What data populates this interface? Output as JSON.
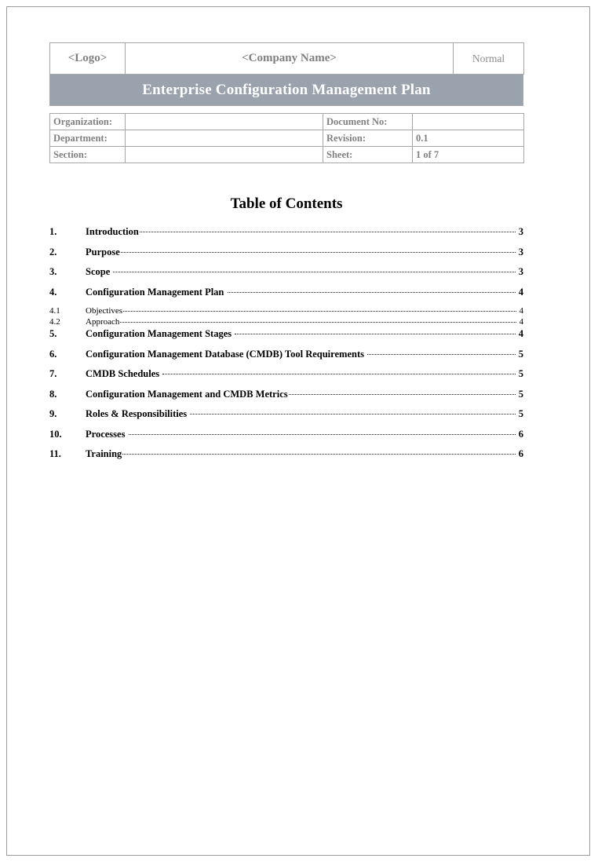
{
  "header": {
    "logo_label": "<Logo>",
    "company_label": "<Company Name>",
    "status_label": "Normal",
    "document_title": "Enterprise Configuration Management Plan"
  },
  "info_table": {
    "rows": [
      {
        "label_left": "Organization:",
        "value_left": "",
        "label_right": "Document No:",
        "value_right": ""
      },
      {
        "label_left": "Department:",
        "value_left": "",
        "label_right": "Revision:",
        "value_right": "0.1"
      },
      {
        "label_left": "Section:",
        "value_left": "",
        "label_right": "Sheet:",
        "value_right": "1 of 7"
      }
    ]
  },
  "toc": {
    "heading": "Table of Contents",
    "entries": [
      {
        "number": "1.",
        "label": "Introduction",
        "page": "3",
        "level": 1
      },
      {
        "number": "2.",
        "label": "Purpose",
        "page": "3",
        "level": 1
      },
      {
        "number": "3.",
        "label": "Scope ",
        "page": "3",
        "level": 1
      },
      {
        "number": "4.",
        "label": "Configuration Management Plan ",
        "page": "4",
        "level": 1
      },
      {
        "number": "4.1",
        "label": "Objectives",
        "page": "4",
        "level": 2
      },
      {
        "number": "4.2",
        "label": "Approach",
        "page": "4",
        "level": 2
      },
      {
        "number": "5.",
        "label": "Configuration Management Stages ",
        "page": "4",
        "level": 1
      },
      {
        "number": "6.",
        "label": "Configuration Management Database (CMDB) Tool Requirements ",
        "page": "5",
        "level": 1
      },
      {
        "number": "7.",
        "label": "CMDB Schedules ",
        "page": "5",
        "level": 1
      },
      {
        "number": "8.",
        "label": "Configuration Management and CMDB Metrics",
        "page": "5",
        "level": 1
      },
      {
        "number": "9.",
        "label": "Roles & Responsibilities ",
        "page": "5",
        "level": 1
      },
      {
        "number": "10.",
        "label": "Processes ",
        "page": "6",
        "level": 1
      },
      {
        "number": "11.",
        "label": "Training",
        "page": "6",
        "level": 1
      }
    ]
  },
  "colors": {
    "banner_background": "#9aa2ae",
    "banner_text": "#ffffff",
    "table_label_text": "#808080",
    "border": "#a6a6a6",
    "page_border": "#9d9d9d"
  }
}
